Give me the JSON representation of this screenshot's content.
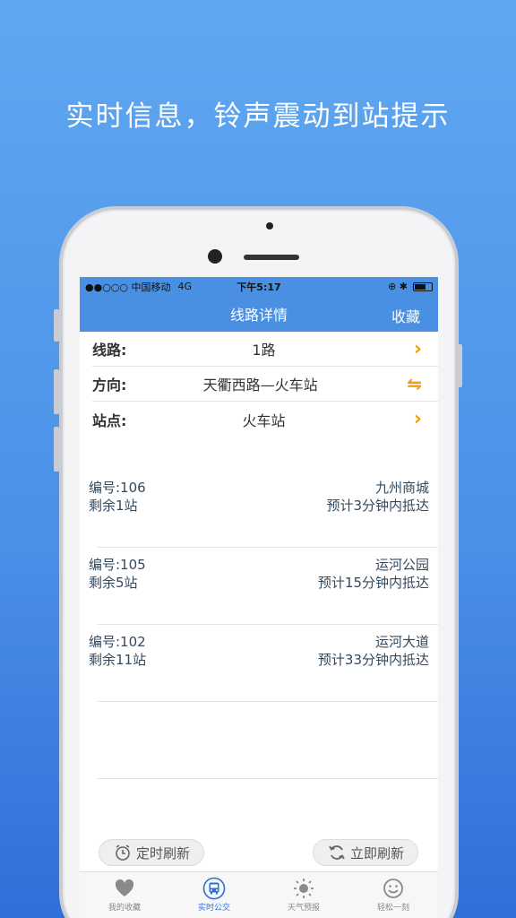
{
  "headline": "实时信息，铃声震动到站提示",
  "status": {
    "carrier": "●●○○○ 中国移动",
    "network": "4G",
    "time": "下午5:17",
    "extras": "⊕ ✱"
  },
  "nav": {
    "title": "线路详情",
    "favorite": "收藏"
  },
  "route": {
    "line_label": "线路:",
    "line_value": "1路",
    "direction_label": "方向:",
    "direction_value": "天衢西路—火车站",
    "stop_label": "站点:",
    "stop_value": "火车站"
  },
  "buses": [
    {
      "id": "编号:106",
      "remaining": "剩余1站",
      "stop": "九州商城",
      "eta": "预计3分钟内抵达"
    },
    {
      "id": "编号:105",
      "remaining": "剩余5站",
      "stop": "运河公园",
      "eta": "预计15分钟内抵达"
    },
    {
      "id": "编号:102",
      "remaining": "剩余11站",
      "stop": "运河大道",
      "eta": "预计33分钟内抵达"
    }
  ],
  "buttons": {
    "timed_refresh": "定时刷新",
    "refresh_now": "立即刷新"
  },
  "tabs": [
    {
      "label": "我的收藏",
      "icon": "heart-icon"
    },
    {
      "label": "实时公交",
      "icon": "bus-icon"
    },
    {
      "label": "天气预报",
      "icon": "sun-icon"
    },
    {
      "label": "轻松一刻",
      "icon": "smile-icon"
    }
  ],
  "colors": {
    "accent": "#4a90e2",
    "chevron": "#f39c12",
    "active_tab": "#2d6fd6"
  }
}
